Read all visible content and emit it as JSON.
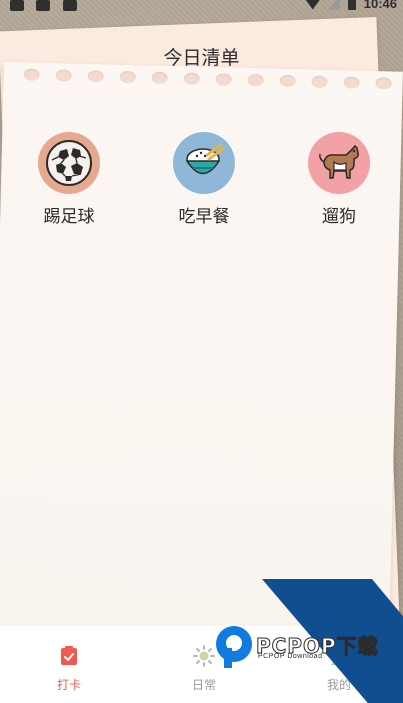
{
  "status_bar": {
    "time": "10:46"
  },
  "page": {
    "title": "今日清单"
  },
  "habits": [
    {
      "label": "踢足球",
      "icon": "soccer-ball-icon",
      "color": "#e6a88e"
    },
    {
      "label": "吃早餐",
      "icon": "rice-bowl-icon",
      "color": "#8fb7d8"
    },
    {
      "label": "遛狗",
      "icon": "dog-icon",
      "color": "#f2a1a4"
    }
  ],
  "bottom_nav": [
    {
      "label": "打卡",
      "icon": "clipboard-check-icon",
      "active": true
    },
    {
      "label": "日常",
      "icon": "sun-icon",
      "active": false
    },
    {
      "label": "我的",
      "icon": "user-icon",
      "active": false
    }
  ],
  "watermark": {
    "brand": "PCPOP下载",
    "sub": "PCPOP Download"
  },
  "colors": {
    "accent": "#f05a4f",
    "inactive": "#9a9a9a",
    "paper": "#faf4ef",
    "watermark_blue": "#114e8f"
  }
}
